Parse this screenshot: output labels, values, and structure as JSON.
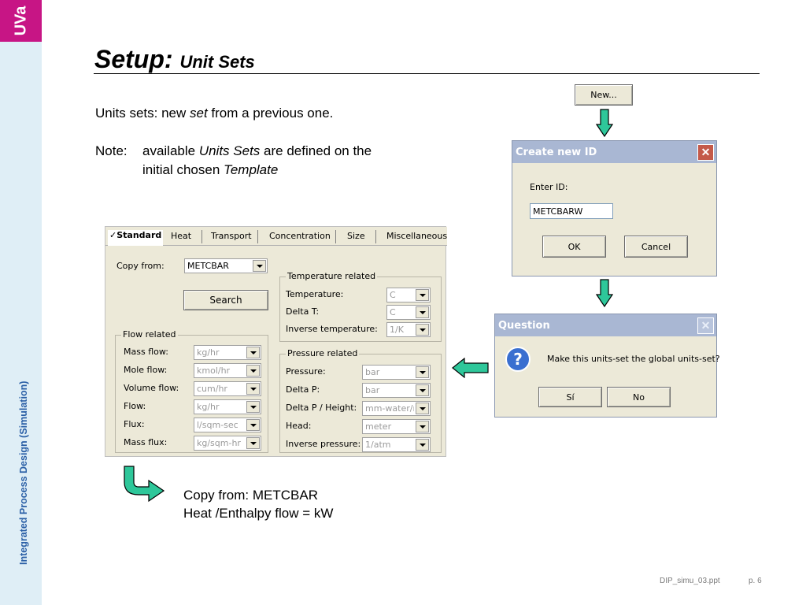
{
  "sidebar": {
    "logo": "UVa",
    "course": "Integrated Process Design (Simulation)"
  },
  "slide": {
    "title": "Setup:",
    "subtitle": "Unit Sets"
  },
  "text": {
    "line1_a": "Units sets: new ",
    "line1_em": "set",
    "line1_b": " from a previous one.",
    "note_label": "Note:",
    "note_a": "available ",
    "note_em1": "Units Sets",
    "note_b": " are defined on the",
    "note_c": "initial chosen ",
    "note_em2": "Template",
    "copy_line1": "Copy from: METCBAR",
    "copy_line2": "Heat /Enthalpy flow = kW"
  },
  "new_button": "New...",
  "create_dialog": {
    "title": "Create new ID",
    "close": "✕",
    "enter_label": "Enter ID:",
    "id_value": "METCBARW",
    "ok": "OK",
    "cancel": "Cancel"
  },
  "question_dialog": {
    "title": "Question",
    "close": "✕",
    "message": "Make this units-set the global units-set?",
    "yes": "Sí",
    "no": "No"
  },
  "panel": {
    "tabs": [
      "✓Standard",
      "Heat",
      "Transport",
      "Concentration",
      "Size",
      "Miscellaneous"
    ],
    "copy_from_label": "Copy from:",
    "copy_from_value": "METCBAR",
    "search": "Search",
    "flow_group": "Flow related",
    "flow": [
      {
        "label": "Mass flow:",
        "value": "kg/hr"
      },
      {
        "label": "Mole flow:",
        "value": "kmol/hr"
      },
      {
        "label": "Volume flow:",
        "value": "cum/hr"
      },
      {
        "label": "Flow:",
        "value": "kg/hr"
      },
      {
        "label": "Flux:",
        "value": "l/sqm-sec"
      },
      {
        "label": "Mass flux:",
        "value": "kg/sqm-hr"
      }
    ],
    "temp_group": "Temperature related",
    "temp": [
      {
        "label": "Temperature:",
        "value": "C"
      },
      {
        "label": "Delta T:",
        "value": "C"
      },
      {
        "label": "Inverse temperature:",
        "value": "1/K"
      }
    ],
    "press_group": "Pressure related",
    "press": [
      {
        "label": "Pressure:",
        "value": "bar"
      },
      {
        "label": "Delta P:",
        "value": "bar"
      },
      {
        "label": "Delta P / Height:",
        "value": "mm-water/m"
      },
      {
        "label": "Head:",
        "value": "meter"
      },
      {
        "label": "Inverse pressure:",
        "value": "1/atm"
      }
    ]
  },
  "footer": {
    "file": "DIP_simu_03.ppt",
    "page": "p. 6"
  },
  "colors": {
    "arrow_fill": "#2ec79a",
    "logo_bg": "#c71585",
    "sidebar_bg": "#dfeef6",
    "sidebar_text": "#2a5fa6"
  }
}
